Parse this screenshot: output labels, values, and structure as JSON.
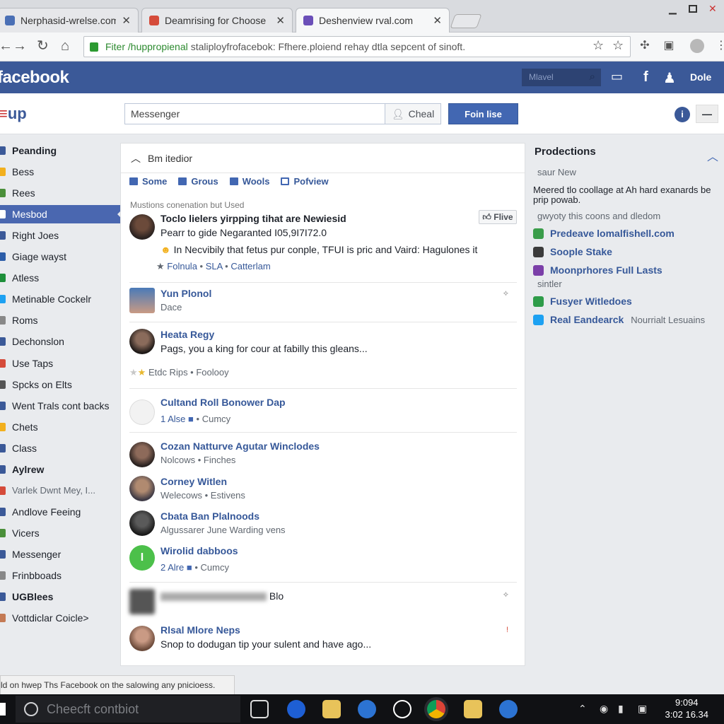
{
  "browser": {
    "tabs": [
      {
        "title": "Nerphasid-wrelse.com",
        "favicon_color": "#4a6fb5"
      },
      {
        "title": "Deamrising for Choose",
        "favicon_color": "#d54b3a"
      },
      {
        "title": "Deshenview rval.com",
        "favicon_color": "#6b4fb8"
      }
    ],
    "tab_close": "✕",
    "address_green": "Fiter /huppropienal",
    "address_text": "staliployfrofacebok: Ffhere.ploiend rehay dtla sepcent of sinoft."
  },
  "fb": {
    "logo": "facebook",
    "search_placeholder": "Mlavel",
    "user": "Dole",
    "brand_color": "#3b5998"
  },
  "header": {
    "group_label": "up",
    "messenger_value": "Messenger",
    "chat_label": "Cheal",
    "join_label": "Foin lise",
    "info_label": "i",
    "minus_label": "—"
  },
  "sidebar": {
    "items": [
      {
        "label": "Peanding",
        "type": "head",
        "color": "#3b5998"
      },
      {
        "label": "Bess",
        "type": "item",
        "color": "#f2b01e"
      },
      {
        "label": "Rees",
        "type": "item",
        "color": "#4a8f3a"
      },
      {
        "label": "Mesbod",
        "type": "sel",
        "color": "#ffffff"
      },
      {
        "label": "Right Joes",
        "type": "item",
        "color": "#3b5998"
      },
      {
        "label": "Giage wayst",
        "type": "item",
        "color": "#2c5da8"
      },
      {
        "label": "Atless",
        "type": "item",
        "color": "#1d8f3a"
      },
      {
        "label": "Metinable Cockelr",
        "type": "item",
        "color": "#1da1f2"
      },
      {
        "label": "Roms",
        "type": "item",
        "color": "#888888"
      },
      {
        "label": "Dechonslon",
        "type": "item",
        "color": "#3b5998"
      },
      {
        "label": "Use Taps",
        "type": "item",
        "color": "#d54b3a"
      },
      {
        "label": "Spcks on Elts",
        "type": "item",
        "color": "#555555"
      },
      {
        "label": "Went Trals cont backs",
        "type": "item",
        "color": "#3b5998"
      },
      {
        "label": "Chets",
        "type": "item",
        "color": "#f2b01e"
      },
      {
        "label": "Class",
        "type": "item",
        "color": "#3b5998"
      },
      {
        "label": "Aylrew",
        "type": "head",
        "color": "#3b5998"
      },
      {
        "label": "Varlek Dwnt Mey, I...",
        "type": "sub",
        "color": "#d54b3a"
      },
      {
        "label": "Andlove Feeing",
        "type": "item",
        "color": "#3b5998"
      },
      {
        "label": "Vicers",
        "type": "item",
        "color": "#4a8f3a"
      },
      {
        "label": "Messenger",
        "type": "item",
        "color": "#3b5998"
      },
      {
        "label": "Frinbboads",
        "type": "item",
        "color": "#888888"
      },
      {
        "label": "UGBlees",
        "type": "head",
        "color": "#3b5998"
      },
      {
        "label": "Vottdiclar Coicle>",
        "type": "item",
        "color": "#c47a55"
      }
    ]
  },
  "feed": {
    "header": "Bm itedior",
    "tabs": [
      "Some",
      "Grous",
      "Wools",
      "Pofview"
    ],
    "section_label": "Mustions conenation but Used",
    "like_label": "Flive",
    "posts": [
      {
        "title": "Toclo lielers yirpping tihat are Newiesid",
        "line1": "Pearr to gide Negaranted I05,9I7I72.0",
        "line2": "In Necvibily that fetus pur conple, TFUI is pric and Vaird: Hagulones it",
        "meta": [
          "Folnula",
          "SLA",
          "Catterlam"
        ]
      },
      {
        "title": "Yun Plonol",
        "meta": "Dace"
      },
      {
        "title": "Heata Regy",
        "line1": "Pags, you a king for cour at fabilly this gleans...",
        "meta": "Etdc Rips • Foolooy"
      },
      {
        "title": "Cultand Roll Bonower Dap",
        "meta_blue": "1  Alse",
        "meta": "• Cumcy"
      },
      {
        "title": "Cozan Natturve Agutar Winclodes",
        "meta": "Nolcows • Finches"
      },
      {
        "title": "Corney Witlen",
        "meta": "Welecows • Estivens"
      },
      {
        "title": "Cbata Ban Plalnoods",
        "meta": "Algussarer June Warding vens"
      },
      {
        "title": "Wirolid dabboos",
        "meta_blue": "2  Alre",
        "meta": "• Cumcy"
      },
      {
        "title": "Blo"
      },
      {
        "title": "Rlsal Mlore Neps",
        "line1": "Snop to dodugan tip your sulent and have ago..."
      }
    ]
  },
  "right": {
    "title": "Prodections",
    "items": [
      {
        "text": "saur New",
        "style": "gray"
      },
      {
        "text": "Meered tlo coollage at Ah hard exanards be prip powab.",
        "style": "plain"
      },
      {
        "text": "gwyoty this coons and dledom",
        "style": "gray"
      },
      {
        "text": "Predeave lomalfishell.com",
        "style": "link",
        "color": "#3a9d4a"
      },
      {
        "text": "Soople Stake",
        "style": "link",
        "color": "#3b3b3b"
      },
      {
        "text": "Moonprhores Full Lasts",
        "style": "link",
        "color": "#7b3fa8"
      },
      {
        "text": "sintler",
        "style": "gray"
      },
      {
        "text": "Fusyer Witledoes",
        "style": "link",
        "color": "#2e9c49"
      },
      {
        "text": "Real Eandearck",
        "extra": "Nourrialt Lesuains",
        "style": "link",
        "color": "#1da1f2"
      }
    ]
  },
  "status_text": "ld on hwep Ths Facebook on the salowing any pnicioess.",
  "taskbar": {
    "search_placeholder": "Cheecft contbiot",
    "time": "9:094",
    "date": "3:02 16.34"
  }
}
